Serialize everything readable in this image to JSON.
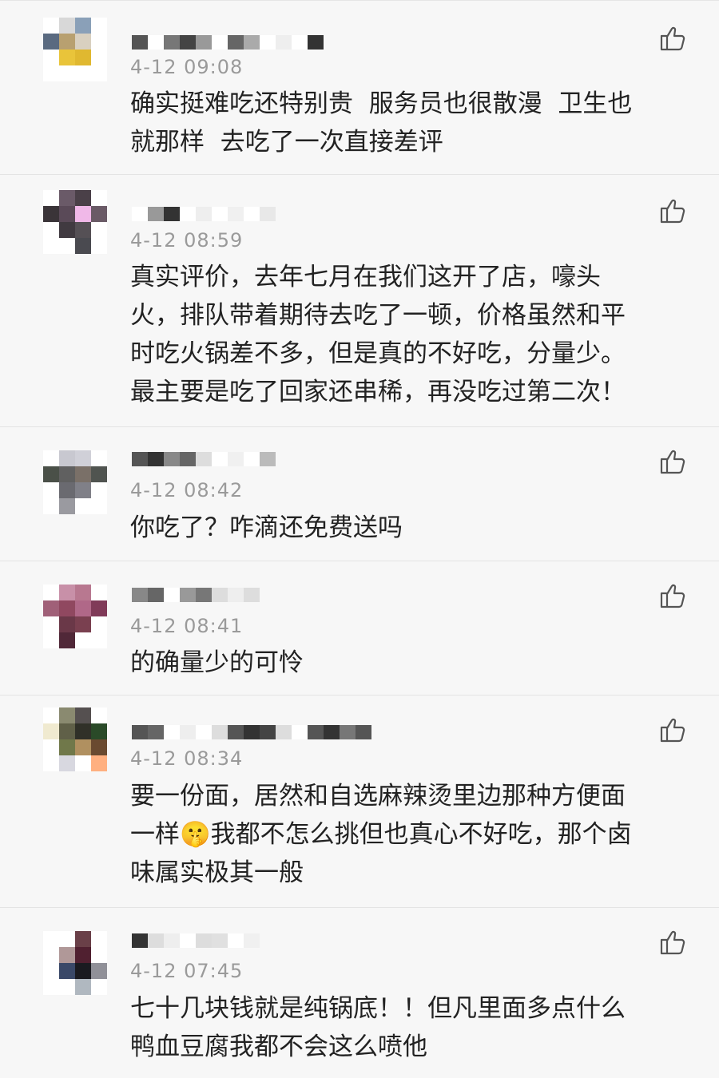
{
  "comments": [
    {
      "time": "4-12 09:08",
      "text": "确实挺难吃还特别贵  服务员也很散漫  卫生也\n就那样  去吃了一次直接差评",
      "avatar_colors": [
        "#ffffff",
        "#d8d8d8",
        "#8aa0b8",
        "#ffffff",
        "#5a6a80",
        "#b8a070",
        "#d9d0c0",
        "#ffffff",
        "#ffffff",
        "#e9c43a",
        "#e0b830",
        "#ffffff",
        "#ffffff",
        "#ffffff",
        "#ffffff",
        "#ffffff"
      ],
      "name_blocks": [
        "#555",
        "#fff",
        "#777",
        "#444",
        "#999",
        "#fff",
        "#666",
        "#aaa",
        "#fff",
        "#eee",
        "#fff",
        "#333"
      ]
    },
    {
      "time": "4-12 08:59",
      "text": "真实评价，去年七月在我们这开了店，嚎头\n火，排队带着期待去吃了一顿，价格虽然和平\n时吃火锅差不多，但是真的不好吃，分量少。\n最主要是吃了回家还串稀，再没吃过第二次！",
      "avatar_colors": [
        "#ffffff",
        "#6a5a68",
        "#4a4048",
        "#ffffff",
        "#3a3438",
        "#5a4a58",
        "#f0b8e8",
        "#6a5a66",
        "#ffffff",
        "#403a40",
        "#555055",
        "#ffffff",
        "#ffffff",
        "#ffffff",
        "#4a4a50",
        "#ffffff"
      ],
      "name_blocks": [
        "#fff",
        "#999",
        "#333",
        "#fff",
        "#eee",
        "#fff",
        "#f0f0f0",
        "#fff",
        "#e8e8e8"
      ]
    },
    {
      "time": "4-12 08:42",
      "text": "你吃了？咋滴还免费送吗",
      "avatar_colors": [
        "#ffffff",
        "#c8c8d0",
        "#d0d0d8",
        "#ffffff",
        "#4a5048",
        "#606060",
        "#7a7068",
        "#505450",
        "#ffffff",
        "#6a6a70",
        "#808088",
        "#ffffff",
        "#ffffff",
        "#9a9aa0",
        "#ffffff",
        "#ffffff"
      ],
      "name_blocks": [
        "#555",
        "#333",
        "#888",
        "#666",
        "#ddd",
        "#fff",
        "#f0f0f0",
        "#fff",
        "#bbb"
      ]
    },
    {
      "time": "4-12 08:41",
      "text": "的确量少的可怜",
      "avatar_colors": [
        "#ffffff",
        "#c890a8",
        "#b87890",
        "#ffffff",
        "#a06078",
        "#904860",
        "#b06888",
        "#803a58",
        "#ffffff",
        "#6a3848",
        "#7a4050",
        "#ffffff",
        "#ffffff",
        "#502838",
        "#ffffff",
        "#ffffff"
      ],
      "name_blocks": [
        "#888",
        "#666",
        "#fff",
        "#999",
        "#777",
        "#ddd",
        "#eee",
        "#ddd"
      ]
    },
    {
      "time": "4-12 08:34",
      "text": "要一份面，居然和自选麻辣烫里边那种方便面\n一样🤫我都不怎么挑但也真心不好吃，那个卤\n味属实极其一般",
      "avatar_colors": [
        "#ffffff",
        "#8a8a70",
        "#555050",
        "#ffffff",
        "#f0ead0",
        "#606048",
        "#303028",
        "#2a4a28",
        "#ffffff",
        "#70784a",
        "#b09060",
        "#6a4a30",
        "#ffffff",
        "#d8d8e0",
        "#ffffff",
        "#ffb080"
      ],
      "name_blocks": [
        "#555",
        "#666",
        "#fff",
        "#eee",
        "#fff",
        "#ddd",
        "#555",
        "#333",
        "#444",
        "#ddd",
        "#fff",
        "#555",
        "#333",
        "#777",
        "#555"
      ]
    },
    {
      "time": "4-12 07:45",
      "text": "七十几块钱就是纯锅底！！但凡里面多点什么\n鸭血豆腐我都不会这么喷他",
      "avatar_colors": [
        "#ffffff",
        "#ffffff",
        "#6a4048",
        "#ffffff",
        "#ffffff",
        "#b09898",
        "#502030",
        "#ffffff",
        "#ffffff",
        "#3a4868",
        "#1a1a20",
        "#909098",
        "#ffffff",
        "#ffffff",
        "#b0b8c0",
        "#ffffff"
      ],
      "name_blocks": [
        "#333",
        "#ddd",
        "#eee",
        "#fff",
        "#ddd",
        "#e0e0e0",
        "#fff",
        "#f0f0f0"
      ]
    }
  ]
}
